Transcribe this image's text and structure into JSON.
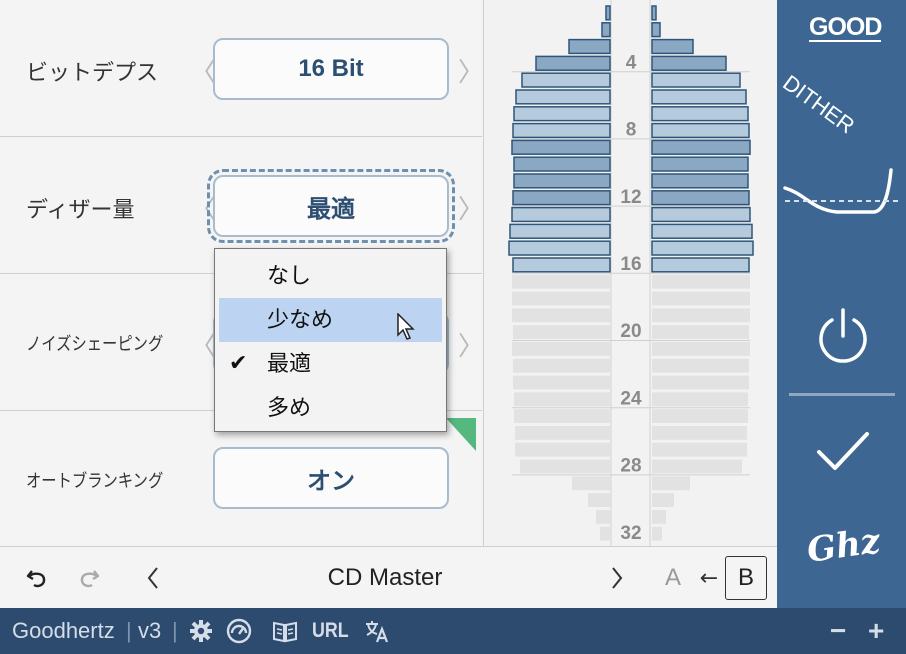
{
  "settings": {
    "bit_depth": {
      "label": "ビットデプス",
      "value": "16 Bit"
    },
    "dither_amount": {
      "label": "ディザー量",
      "value": "最適"
    },
    "noise_shaping": {
      "label": "ノイズシェーピング"
    },
    "auto_blanking": {
      "label": "オートブランキング",
      "value": "オン"
    },
    "arrow_left": "〈",
    "arrow_right": "〉"
  },
  "dropdown": {
    "options": [
      {
        "label": "なし",
        "selected": false,
        "highlighted": false
      },
      {
        "label": "少なめ",
        "selected": false,
        "highlighted": true
      },
      {
        "label": "最適",
        "selected": true,
        "highlighted": false
      },
      {
        "label": "多め",
        "selected": false,
        "highlighted": false
      }
    ],
    "check_mark": "✔"
  },
  "bit_meter": {
    "scale_labels": [
      "4",
      "8",
      "12",
      "16",
      "20",
      "24",
      "28",
      "32"
    ],
    "active_bits": 16,
    "colors": {
      "active_dark": "#8aa7c4",
      "active_light": "#b6cadd",
      "inactive": "#e2e2e2",
      "stroke": "#2f5679"
    }
  },
  "sidebar": {
    "logo_top": "GOOD",
    "logo_bottom": "DITHER",
    "brand_mark": "Ghz"
  },
  "preset_bar": {
    "preset_name": "CD Master",
    "ab_a": "A",
    "ab_arrow": "←",
    "ab_b": "B"
  },
  "footer": {
    "brand": "Goodhertz",
    "version": "v3",
    "url_label": "URL",
    "minus": "−",
    "plus": "+"
  },
  "colors": {
    "accent": "#3d6792",
    "footer_bg": "#2d4b6e",
    "highlight": "#bcd3f2"
  }
}
